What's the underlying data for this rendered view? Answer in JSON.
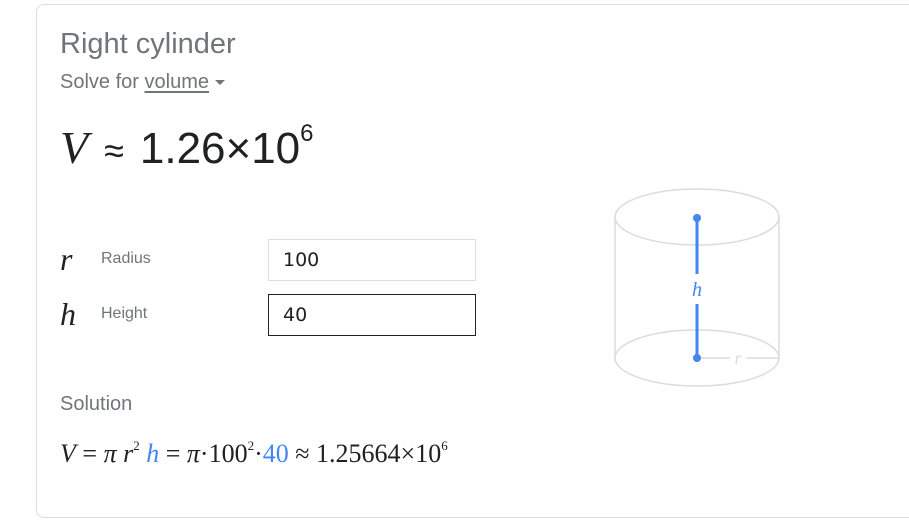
{
  "card": {
    "title": "Right cylinder",
    "solve_for_prefix": "Solve for",
    "solve_for_target": "volume",
    "result": {
      "symbol": "V",
      "approx": "≈",
      "mantissa": "1.26×10",
      "exponent": "6"
    },
    "variables": [
      {
        "symbol": "r",
        "label": "Radius",
        "value": "100",
        "active": false
      },
      {
        "symbol": "h",
        "label": "Height",
        "value": "40",
        "active": true
      }
    ],
    "solution": {
      "label": "Solution",
      "lhs": "V",
      "eq1": "=",
      "pi": "π",
      "r": "r",
      "r_exp": "2",
      "h": "h",
      "eq2": "=",
      "pi2": "π",
      "dot1": "·",
      "r_value": "100",
      "r_value_exp": "2",
      "dot2": "·",
      "h_value": "40",
      "approx": "≈",
      "result_mantissa": "1.25664×10",
      "result_exp": "6"
    },
    "diagram": {
      "height_label": "h",
      "radius_label": "r",
      "accent_color": "#4285f4",
      "outline_color": "#dadce0"
    }
  }
}
